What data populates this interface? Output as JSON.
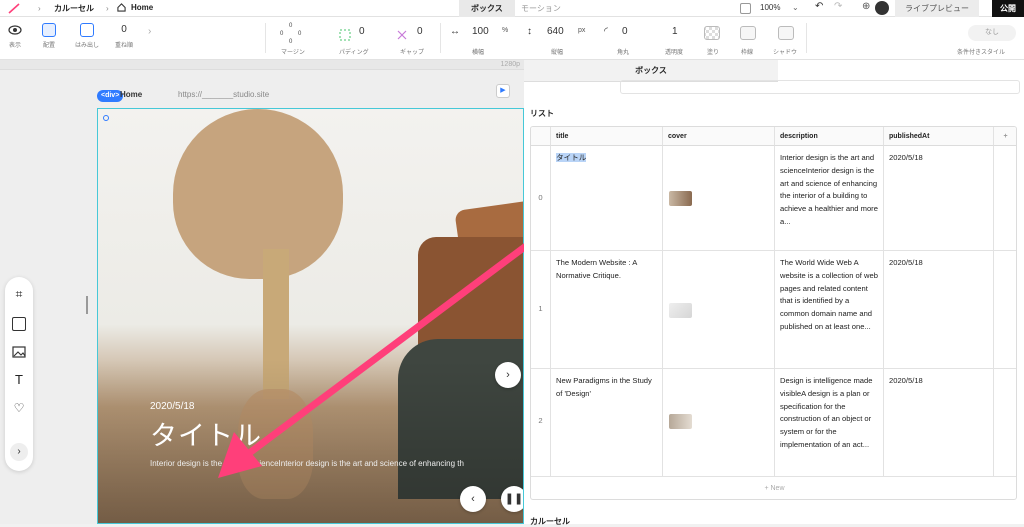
{
  "topbar": {
    "breadcrumb": [
      "カルーセル",
      "Home"
    ],
    "mode_tabs": [
      {
        "label": "ボックス"
      },
      {
        "label": "モーション"
      }
    ],
    "zoom": "100%",
    "preview_label": "ライブプレビュー",
    "publish_label": "公開"
  },
  "toolbar": {
    "display_label": "表示",
    "align_label": "配置",
    "overflow_label": "はみ出し",
    "stack_value": "0",
    "stack_label": "重ね順",
    "margin_values": [
      "0",
      "0",
      "0",
      "0"
    ],
    "margin_label": "マージン",
    "padding_value": "0",
    "padding_label": "パディング",
    "gap_value": "0",
    "gap_label": "ギャップ",
    "width_value": "100",
    "width_unit": "%",
    "width_label": "横幅",
    "height_value": "640",
    "height_unit": "px",
    "height_label": "縦幅",
    "radius_value": "0",
    "radius_label": "角丸",
    "opacity_value": "1",
    "opacity_label": "透明度",
    "fill_label": "塗り",
    "border_label": "枠線",
    "shadow_label": "シャドウ",
    "condition_value": "なし",
    "condition_label": "条件付きスタイル"
  },
  "canvas": {
    "ruler_value": "1280p",
    "div_badge": "<div>",
    "home_text": "Home",
    "url_text": "https://_______studio.site",
    "slide": {
      "date": "2020/5/18",
      "title": "タイトル",
      "description": "Interior design is the art and scienceInterior design is the art and science of enhancing th"
    }
  },
  "panel": {
    "tab_label": "ボックス",
    "list_label": "リスト",
    "columns": [
      "title",
      "cover",
      "description",
      "publishedAt"
    ],
    "rows": [
      {
        "index": "0",
        "title": "タイトル",
        "description": "Interior design is the art and scienceInterior design is the art and science of enhancing the interior of a building to achieve a healthier and more a...",
        "publishedAt": "2020/5/18"
      },
      {
        "index": "1",
        "title": "The Modern Website : A Normative Critique.",
        "description": "The World Wide Web A website is a collection of web pages and related content that is identified by a common domain name and published on at least one...",
        "publishedAt": "2020/5/18"
      },
      {
        "index": "2",
        "title": "New Paradigms in the Study of 'Design'",
        "description": "Design is intelligence made visibleA design is a plan or specification for the construction of an object or system or for the implementation of an act...",
        "publishedAt": "2020/5/18"
      }
    ],
    "add_column": "+",
    "new_row_label": "+ New",
    "footer_label": "カルーセル"
  }
}
